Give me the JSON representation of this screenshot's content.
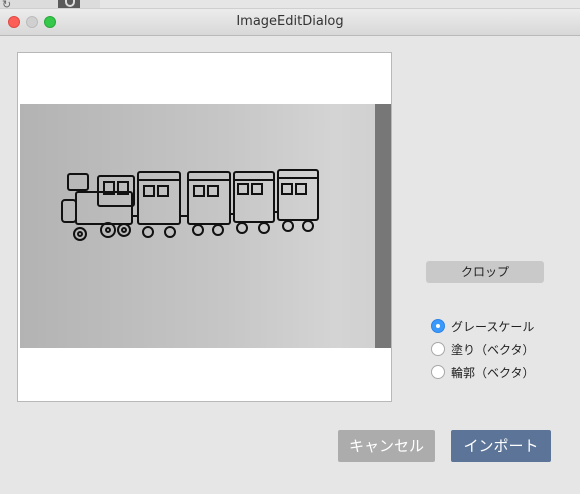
{
  "window": {
    "title": "ImageEditDialog"
  },
  "background_window": {
    "icons": [
      "refresh-icon",
      "tool-icon"
    ]
  },
  "preview": {
    "image_description_icon": "train-drawing-photo"
  },
  "crop_button": {
    "label": "クロップ"
  },
  "mode_options": [
    {
      "label": "グレースケール",
      "selected": true
    },
    {
      "label": "塗り（ベクタ）",
      "selected": false
    },
    {
      "label": "輪郭（ベクタ）",
      "selected": false
    }
  ],
  "footer": {
    "cancel_label": "キャンセル",
    "import_label": "インポート"
  },
  "colors": {
    "close": "#fc5f57",
    "maximize": "#35c84a",
    "radio_selected": "#3b99fc",
    "import_button": "#5b7497",
    "cancel_button": "#acacac"
  }
}
